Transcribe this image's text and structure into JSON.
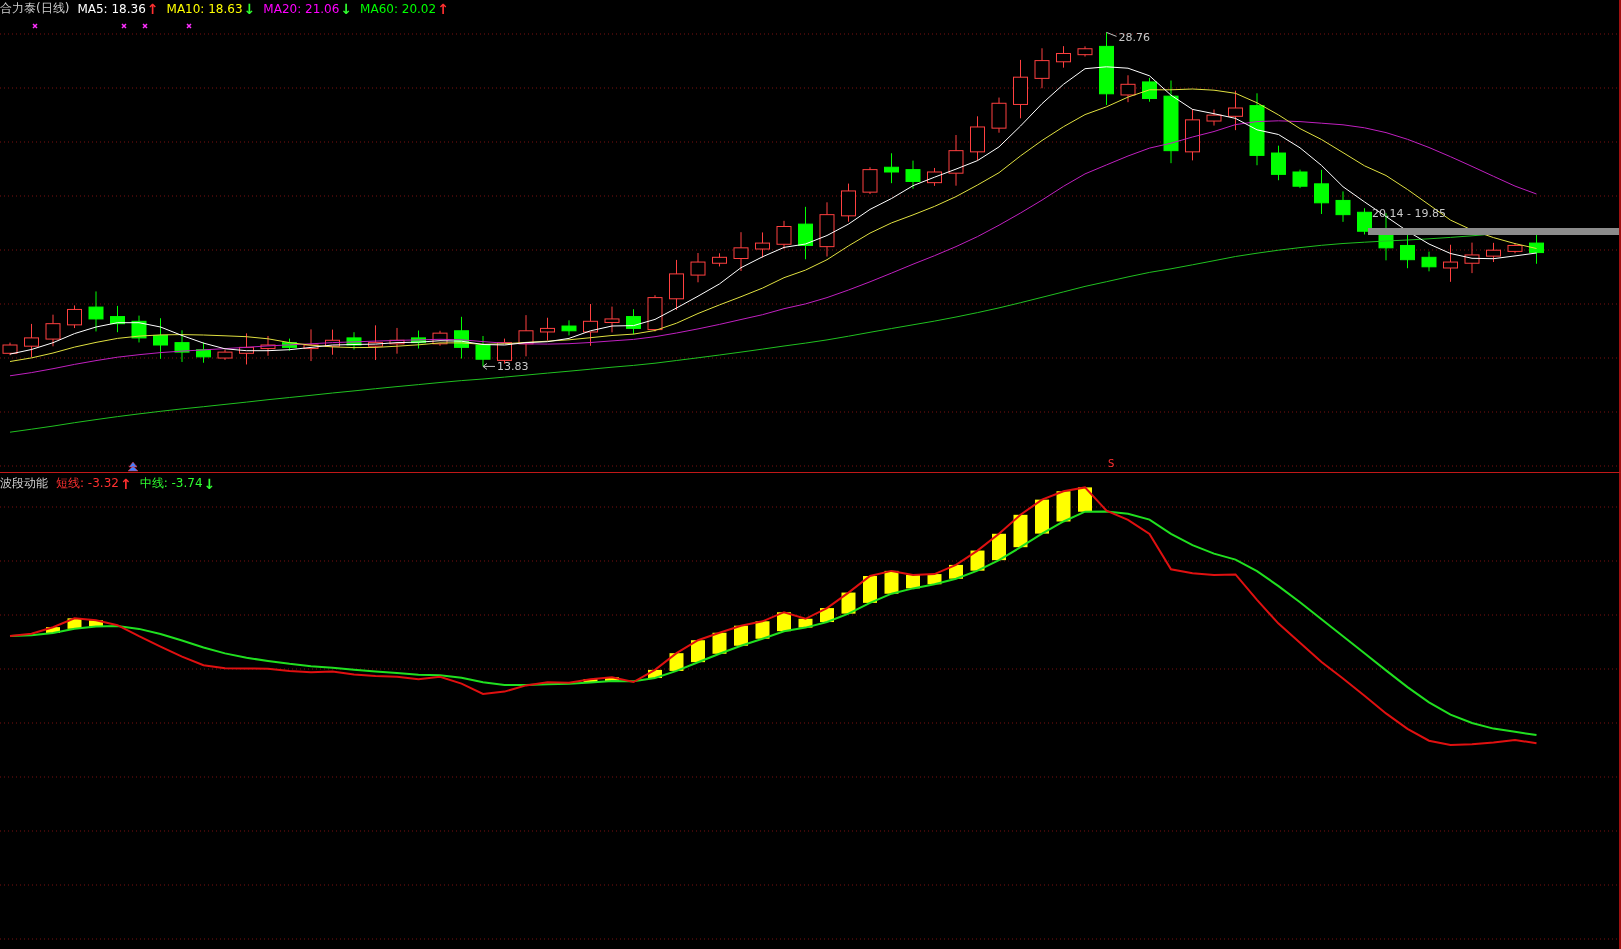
{
  "price_pane": {
    "title": "合力泰(日线)",
    "indicators": [
      {
        "label": "MA5: 18.36",
        "arrow": {
          "text": "↑",
          "color": "#ff3030"
        },
        "color": "#ffffff"
      },
      {
        "label": "MA10: 18.63",
        "arrow": {
          "text": "↓",
          "color": "#30ff30"
        },
        "color": "#ffff00"
      },
      {
        "label": "MA20: 21.06",
        "arrow": {
          "text": "↓",
          "color": "#30ff30"
        },
        "color": "#ff00ff"
      },
      {
        "label": "MA60: 20.02",
        "arrow": {
          "text": "↑",
          "color": "#ff3030"
        },
        "color": "#00ff00"
      }
    ],
    "annotations": [
      {
        "kind": "high",
        "text": "28.76"
      },
      {
        "kind": "low",
        "text": "13.83"
      },
      {
        "kind": "range",
        "text": "20.14 - 19.85"
      }
    ]
  },
  "indicator_pane": {
    "title": "波段动能",
    "indicators": [
      {
        "label": "短线: -3.32",
        "arrow": {
          "text": "↑",
          "color": "#ff3030"
        },
        "color": "#ff3030"
      },
      {
        "label": "中线: -3.74",
        "arrow": {
          "text": "↓",
          "color": "#30ff30"
        },
        "color": "#30ff30"
      }
    ],
    "signal": "S"
  }
}
